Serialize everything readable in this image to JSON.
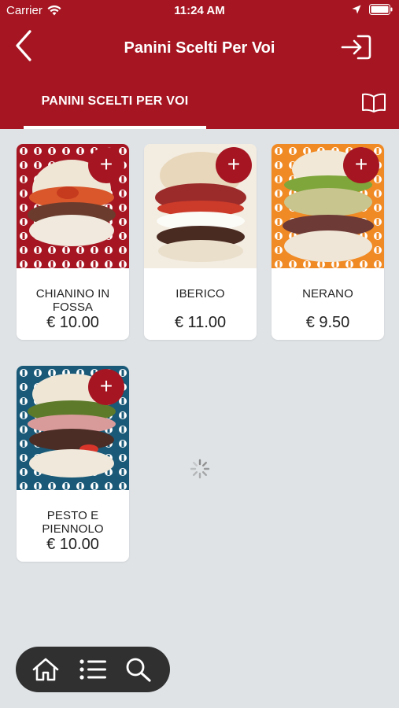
{
  "status_bar": {
    "carrier": "Carrier",
    "time": "11:24 AM"
  },
  "navbar": {
    "title": "Panini Scelti Per Voi",
    "back_icon": "chevron-left-icon",
    "login_icon": "sign-in-icon"
  },
  "tabs": {
    "active_label": "PANINI SCELTI PER VOI",
    "menu_icon": "book-open-icon"
  },
  "products": [
    {
      "name": "CHIANINO IN FOSSA",
      "price": "€ 10.00",
      "pattern_color": "#a51622",
      "add_label": "+"
    },
    {
      "name": "IBERICO",
      "price": "€ 11.00",
      "pattern_color": "#f1e6d2",
      "add_label": "+"
    },
    {
      "name": "NERANO",
      "price": "€ 9.50",
      "pattern_color": "#f08a24",
      "add_label": "+"
    },
    {
      "name": "PESTO E PIENNOLO",
      "price": "€ 10.00",
      "pattern_color": "#1a5a78",
      "add_label": "+"
    }
  ],
  "bottom_nav": {
    "items": [
      "home-icon",
      "list-icon",
      "search-icon"
    ]
  },
  "colors": {
    "brand": "#a51622",
    "background": "#dfe3e6",
    "bottom_bar": "#303030"
  }
}
